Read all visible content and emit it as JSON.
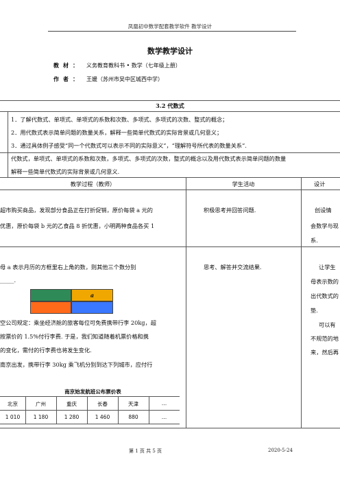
{
  "header": {
    "text": "凤凰初中数学配套教学软件  教学设计"
  },
  "doc": {
    "title": "数学教学设计",
    "textbook_label": "教材：",
    "textbook_value": "义务教育教科书 • 数学（七年级上册）",
    "author_label": "作者：",
    "author_value": "王媛（苏州市吴中区城西中学）"
  },
  "section": {
    "title": "3.2   代数式"
  },
  "objectives": [
    "1．了解代数式、单项式、单项式的系数和次数、多项式、多项式的次数、整式的概念；",
    "2．用代数式表示简单问题的数量关系，解释一些简单代数式的实际背景或几何意义；",
    "3．通过具体例子感受“同一个代数式可以表示不同的实际意义”，“理解符号所代表的数量关系”."
  ],
  "key_points": {
    "line1": "代数式，单项式、单项式的系数和次数，多项式、多项式的次数，整式的概念以及用代数式表示简单问题的数量",
    "line2": "解释一些简单代数式的实际背景或几何意义."
  },
  "table_head": {
    "process": "教学过程（教师）",
    "student": "学生活动",
    "design": "设计"
  },
  "row1": {
    "teacher_l1": "超市购买商品，发现部分食品正在打折促销，原价每袋 a 元的",
    "teacher_l2": "优惠，原价每袋 b 元的乙食品 8 折优惠，小明两种食品各买 1",
    "student": "积极思考并回答问题.",
    "design_l1": "创设情",
    "design_l2": "会数学与现",
    "design_l3": "系."
  },
  "row2": {
    "teacher_l1": "母  a  表示月历的方框里右上角的数，则其他三个数分别",
    "teacher_l2": "_____.",
    "cell_label": "a",
    "teacher_l3": "空公司规定：乘坐经济舱的旅客每位可免费携带行李 20kg，超",
    "teacher_l4": "按票价的 1.5%付行李费. 于是，我们知道随着机票价格和携",
    "teacher_l5": "的变化，需付的行李费也将发生变化.",
    "teacher_l6": "南京出发，携带行李 30kg 乘飞机分别到达下列城市，应付行",
    "student": "思考、解答并交流结果.",
    "design_l1": "让学生",
    "design_l2": "母表示数的",
    "design_l3": "出代数式的",
    "design_l4": "垫.",
    "design_l5": "可以有",
    "design_l6": "不规范的地",
    "design_l7": "来，然后再"
  },
  "fare_table": {
    "title": "南京始发航班公布票价表",
    "cities": [
      "北京",
      "广州",
      "重庆",
      "长春",
      "天津",
      "…"
    ],
    "prices": [
      "1 010",
      "1 180",
      "1 280",
      "1 460",
      "880",
      "…"
    ]
  },
  "colors": {
    "green": "#2e8b57",
    "orange_top": "#f0a800",
    "orange_bottom": "#ff6a1a",
    "blue": "#3a78ff"
  },
  "footer": {
    "page": "第  1  页       共  5  页",
    "date": "2020-5-24"
  }
}
